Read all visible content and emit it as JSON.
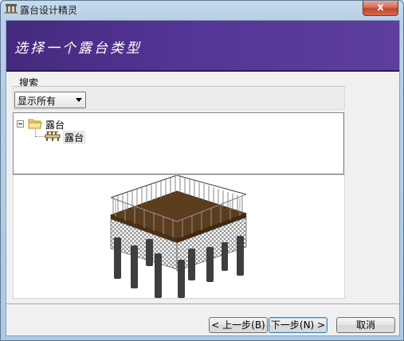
{
  "window": {
    "title": "露台设计精灵",
    "close_glyph": "x"
  },
  "banner": {
    "title": "选择一个露台类型"
  },
  "search": {
    "label": "搜索",
    "filter_selected": "显示所有"
  },
  "tree": {
    "root": {
      "label": "露台",
      "icon": "folder-icon",
      "expanded": true
    },
    "children": [
      {
        "label": "露台",
        "icon": "deck-icon",
        "selected": true
      }
    ]
  },
  "preview": {
    "image": "deck-3d-render",
    "colors": {
      "deck_floor": "#5c3d1e",
      "posts": "#3e3e3e",
      "lattice": "#8a8a8a"
    }
  },
  "buttons": {
    "back": "< 上一步(B)",
    "next": "下一步(N) >",
    "cancel": "取消"
  },
  "colors": {
    "banner": "#4a2f87",
    "titlebar": "#c6dbed",
    "close": "#c2442a"
  }
}
